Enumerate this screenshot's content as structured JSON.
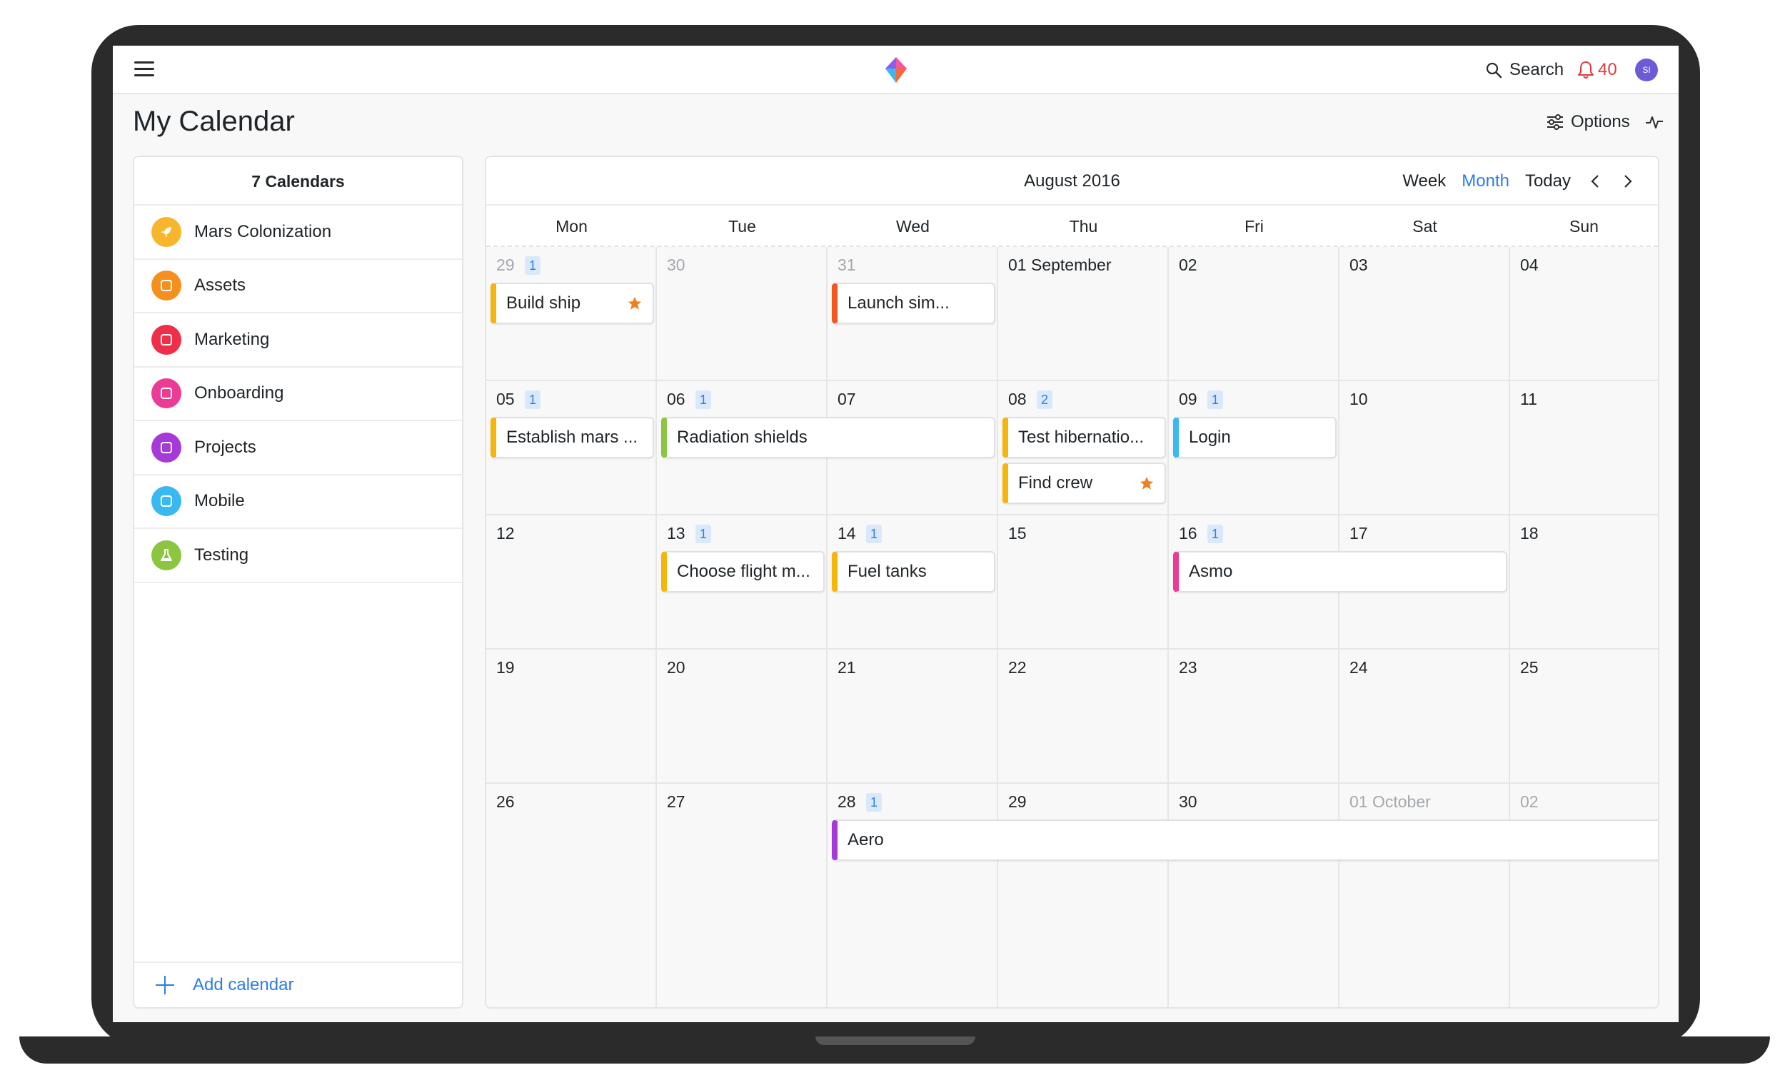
{
  "app": {
    "search_label": "Search",
    "notifications_count": "40",
    "avatar_initials": "SI",
    "page_title": "My Calendar",
    "options_label": "Options"
  },
  "sidebar": {
    "title": "7 Calendars",
    "add_label": "Add calendar",
    "items": [
      {
        "label": "Mars Colonization",
        "color": "#f7b62b",
        "icon": "rocket-icon"
      },
      {
        "label": "Assets",
        "color": "#f5901e",
        "icon": "calendar-square-icon"
      },
      {
        "label": "Marketing",
        "color": "#ef2f49",
        "icon": "calendar-square-icon"
      },
      {
        "label": "Onboarding",
        "color": "#ea3b95",
        "icon": "calendar-square-icon"
      },
      {
        "label": "Projects",
        "color": "#a63ad8",
        "icon": "calendar-square-icon"
      },
      {
        "label": "Mobile",
        "color": "#3ab8f0",
        "icon": "calendar-square-icon"
      },
      {
        "label": "Testing",
        "color": "#8cc53f",
        "icon": "flask-icon"
      }
    ]
  },
  "calendar": {
    "month_title": "August 2016",
    "views": {
      "week": "Week",
      "month": "Month",
      "today": "Today"
    },
    "active_view": "month",
    "weekdays": [
      "Mon",
      "Tue",
      "Wed",
      "Thu",
      "Fri",
      "Sat",
      "Sun"
    ],
    "weeks": [
      [
        {
          "d": "29",
          "muted": true,
          "badge": "1"
        },
        {
          "d": "30",
          "muted": true
        },
        {
          "d": "31",
          "muted": true
        },
        {
          "d": "01 September"
        },
        {
          "d": "02"
        },
        {
          "d": "03"
        },
        {
          "d": "04"
        }
      ],
      [
        {
          "d": "05",
          "badge": "1"
        },
        {
          "d": "06",
          "badge": "1"
        },
        {
          "d": "07"
        },
        {
          "d": "08",
          "badge": "2"
        },
        {
          "d": "09",
          "badge": "1"
        },
        {
          "d": "10"
        },
        {
          "d": "11"
        }
      ],
      [
        {
          "d": "12"
        },
        {
          "d": "13",
          "badge": "1"
        },
        {
          "d": "14",
          "badge": "1"
        },
        {
          "d": "15"
        },
        {
          "d": "16",
          "badge": "1"
        },
        {
          "d": "17"
        },
        {
          "d": "18"
        }
      ],
      [
        {
          "d": "19"
        },
        {
          "d": "20"
        },
        {
          "d": "21"
        },
        {
          "d": "22"
        },
        {
          "d": "23"
        },
        {
          "d": "24"
        },
        {
          "d": "25"
        }
      ],
      [
        {
          "d": "26"
        },
        {
          "d": "27"
        },
        {
          "d": "28",
          "badge": "1"
        },
        {
          "d": "29"
        },
        {
          "d": "30"
        },
        {
          "d": "01 October",
          "muted": true
        },
        {
          "d": "02",
          "muted": true
        }
      ]
    ],
    "events": [
      {
        "title": "Build ship",
        "week": 0,
        "col": 0,
        "span": 1,
        "slot": 0,
        "color": "#f5b50a",
        "star": true
      },
      {
        "title": "Launch sim...",
        "week": 0,
        "col": 2,
        "span": 1,
        "slot": 0,
        "color": "#f2571f",
        "star": false
      },
      {
        "title": "Establish mars ...",
        "week": 1,
        "col": 0,
        "span": 1,
        "slot": 0,
        "color": "#f5b50a",
        "star": false
      },
      {
        "title": "Radiation shields",
        "week": 1,
        "col": 1,
        "span": 2,
        "slot": 0,
        "color": "#8cc53f",
        "star": false
      },
      {
        "title": "Test hibernatio...",
        "week": 1,
        "col": 3,
        "span": 1,
        "slot": 0,
        "color": "#f5b50a",
        "star": false
      },
      {
        "title": "Find crew",
        "week": 1,
        "col": 3,
        "span": 1,
        "slot": 1,
        "color": "#f5b50a",
        "star": true
      },
      {
        "title": "Login",
        "week": 1,
        "col": 4,
        "span": 1,
        "slot": 0,
        "color": "#3ab8f0",
        "star": false
      },
      {
        "title": "Choose flight m...",
        "week": 2,
        "col": 1,
        "span": 1,
        "slot": 0,
        "color": "#f5b50a",
        "star": false
      },
      {
        "title": "Fuel tanks",
        "week": 2,
        "col": 2,
        "span": 1,
        "slot": 0,
        "color": "#f5b50a",
        "star": false
      },
      {
        "title": "Asmo",
        "week": 2,
        "col": 4,
        "span": 2,
        "slot": 0,
        "color": "#ea3b95",
        "star": false
      },
      {
        "title": "Aero",
        "week": 4,
        "col": 2,
        "span": 5,
        "slot": 0,
        "color": "#a63ad8",
        "star": false
      }
    ]
  }
}
